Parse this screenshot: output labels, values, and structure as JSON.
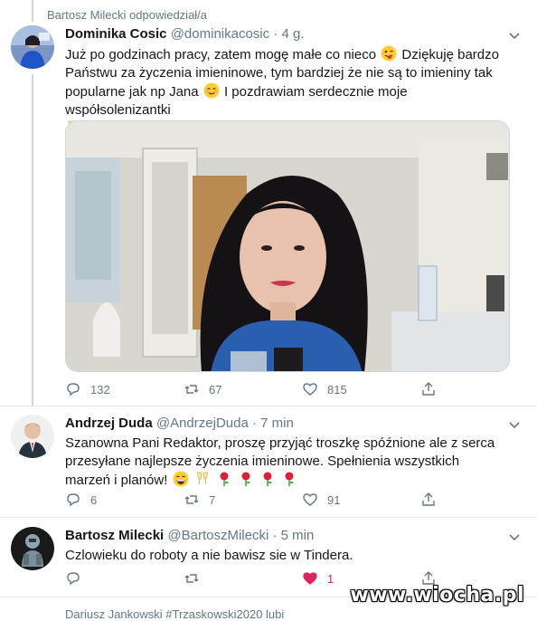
{
  "context_top": {
    "text": "Bartosz Milecki odpowiedział/a"
  },
  "tweets": [
    {
      "name": "Dominika Cosic",
      "handle": "@dominikacosic",
      "time": "· 4 g.",
      "text_1": "Już po godzinach pracy, zatem mogę małe co nieco",
      "text_2": "Dziękuję bardzo Państwu za życzenia imieninowe, tym bardziej że nie są to imieniny tak popularne jak np Jana",
      "text_3": "I pozdrawiam serdecznie moje współsolenizantki",
      "replies": "132",
      "retweets": "67",
      "likes": "815"
    },
    {
      "name": "Andrzej Duda",
      "handle": "@AndrzejDuda",
      "time": "· 7 min",
      "text": "Szanowna Pani Redaktor, proszę przyjąć troszkę spóźnione ale z serca przesyłane najlepsze życzenia imieninowe. Spełnienia wszystkich marzeń i planów!",
      "replies": "6",
      "retweets": "7",
      "likes": "91"
    },
    {
      "name": "Bartosz Milecki",
      "handle": "@BartoszMilecki",
      "time": "· 5 min",
      "text": "Czlowieku do roboty a nie bawisz sie w Tindera.",
      "replies": "",
      "retweets": "",
      "likes": "1"
    }
  ],
  "context_bottom": {
    "text": "Dariusz Jankowski #Trzaskowski2020 lubi"
  },
  "watermark": "www.wiocha.pl",
  "colors": {
    "accent": "#1da1f2",
    "like": "#e0245e",
    "muted": "#657786",
    "line": "#ccd6dd"
  },
  "icons": [
    "reply-icon",
    "retweet-icon",
    "like-icon",
    "share-icon",
    "chevron-down-icon"
  ]
}
